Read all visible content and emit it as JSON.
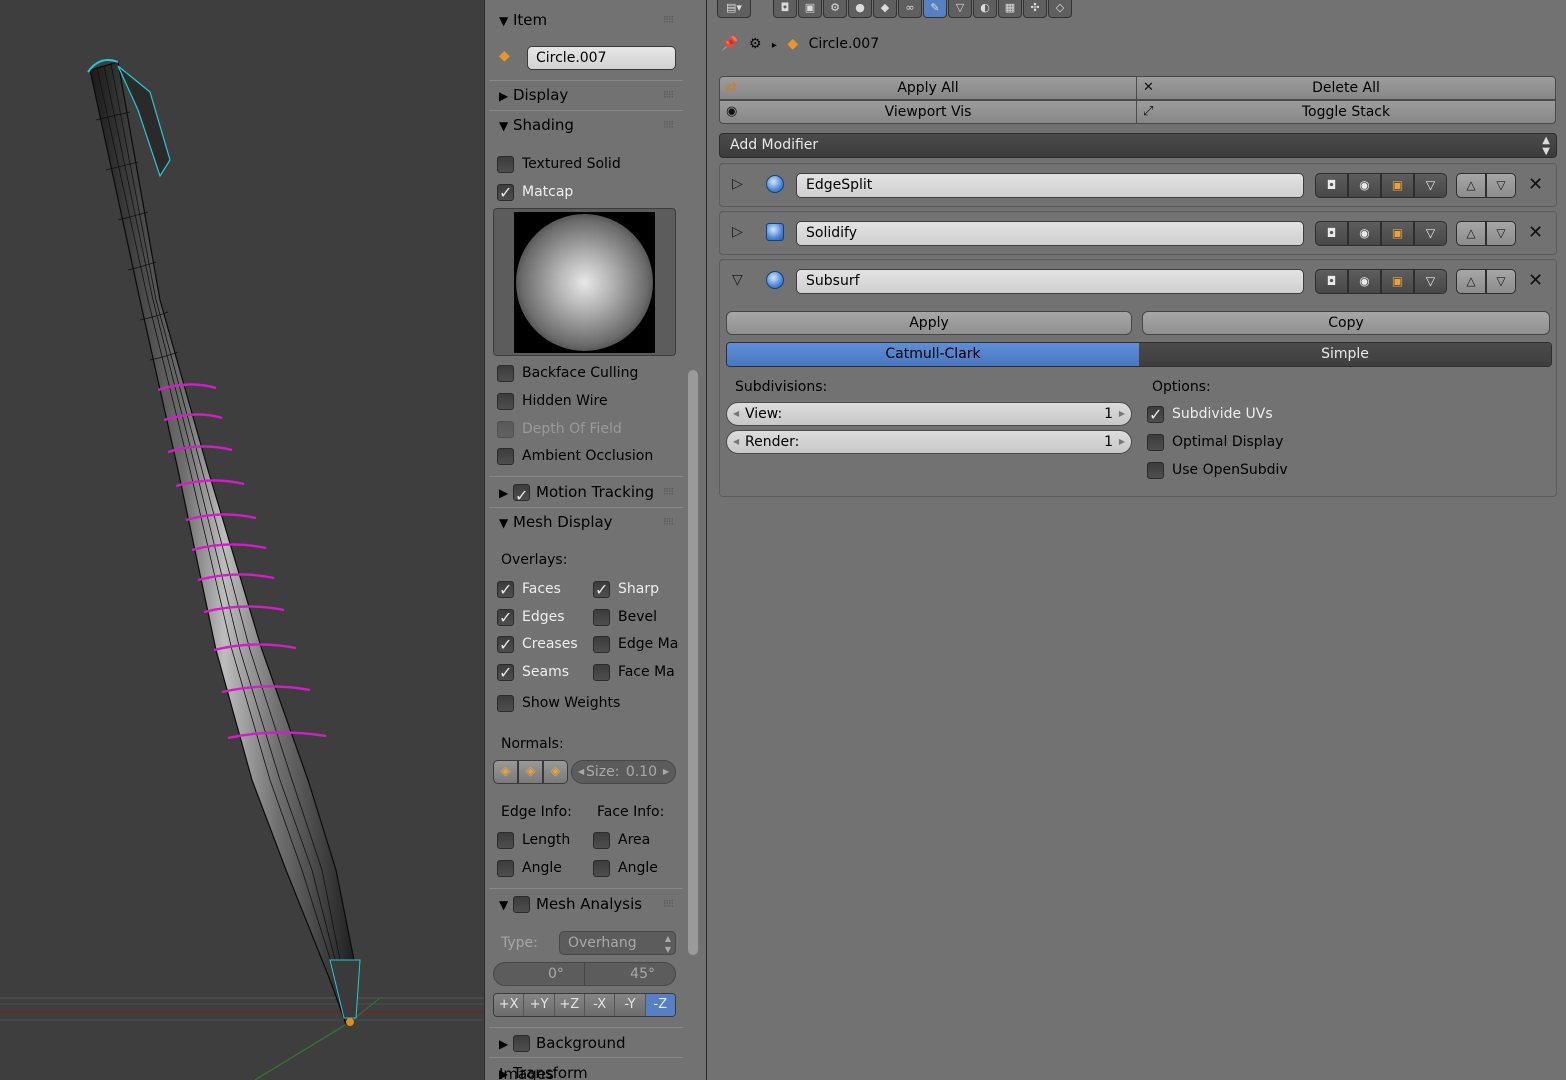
{
  "npanel": {
    "item": {
      "header": "Item",
      "object_name": "Circle.007"
    },
    "display": {
      "header": "Display"
    },
    "shading": {
      "header": "Shading",
      "textured_solid": "Textured Solid",
      "matcap": "Matcap",
      "backface_culling": "Backface Culling",
      "hidden_wire": "Hidden Wire",
      "depth_of_field": "Depth Of Field",
      "ambient_occlusion": "Ambient Occlusion"
    },
    "motion_tracking": {
      "header": "Motion Tracking"
    },
    "mesh_display": {
      "header": "Mesh Display",
      "overlays_label": "Overlays:",
      "faces": "Faces",
      "sharp": "Sharp",
      "edges": "Edges",
      "bevel": "Bevel",
      "creases": "Creases",
      "edge_marks": "Edge Ma",
      "seams": "Seams",
      "face_marks": "Face Ma",
      "show_weights": "Show Weights",
      "normals_label": "Normals:",
      "normals_size_label": "Size:",
      "normals_size_value": "0.10",
      "edge_info_label": "Edge Info:",
      "face_info_label": "Face Info:",
      "edge_length": "Length",
      "face_area": "Area",
      "edge_angle": "Angle",
      "face_angle": "Angle"
    },
    "mesh_analysis": {
      "header": "Mesh Analysis",
      "type_label": "Type:",
      "type_value": "Overhang",
      "min_angle": "0°",
      "max_angle": "45°",
      "axes": [
        "+X",
        "+Y",
        "+Z",
        "-X",
        "-Y",
        "-Z"
      ],
      "active_axis": "-Z"
    },
    "background_images": {
      "header": "Background Images"
    },
    "transform_orientations": {
      "header": "Transform Orientations"
    }
  },
  "props": {
    "breadcrumb_object": "Circle.007",
    "apply_all": "Apply All",
    "delete_all": "Delete All",
    "viewport_vis": "Viewport Vis",
    "toggle_stack": "Toggle Stack",
    "add_modifier": "Add Modifier",
    "modifiers": [
      {
        "name": "EdgeSplit",
        "expanded": false
      },
      {
        "name": "Solidify",
        "expanded": false
      },
      {
        "name": "Subsurf",
        "expanded": true
      }
    ],
    "subsurf": {
      "apply": "Apply",
      "copy": "Copy",
      "catmull_clark": "Catmull-Clark",
      "simple": "Simple",
      "subdivisions_label": "Subdivisions:",
      "view_label": "View:",
      "view_value": "1",
      "render_label": "Render:",
      "render_value": "1",
      "options_label": "Options:",
      "subdivide_uvs": "Subdivide UVs",
      "optimal_display": "Optimal Display",
      "use_opensubdiv": "Use OpenSubdiv"
    }
  },
  "colors": {
    "accent_blue": "#5680c2",
    "seam_magenta": "#d21ec8",
    "panel_gray": "#727272",
    "viewport_bg": "#3e3e3e"
  }
}
